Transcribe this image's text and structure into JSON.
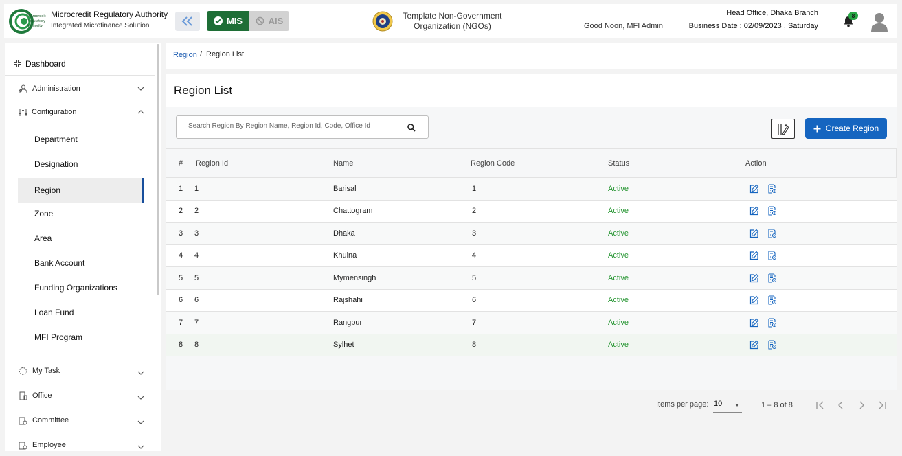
{
  "header": {
    "logo_text": [
      "Microcredit",
      "Regulatory",
      "Authority"
    ],
    "app_title": "Microcredit Regulatory Authority",
    "app_subtitle": "Integrated Microfinance Solution",
    "mis_label": "MIS",
    "ais_label": "AIS",
    "org_line1": "Template Non-Government",
    "org_line2": "Organization (NGOs)",
    "greeting": "Good Noon, MFI Admin",
    "branch": "Head Office, Dhaka Branch",
    "business_date": "Business Date : 02/09/2023 , Saturday",
    "notification_count": "8"
  },
  "sidebar": {
    "dashboard": "Dashboard",
    "items": [
      {
        "label": "Administration",
        "icon": "users-icon"
      },
      {
        "label": "Configuration",
        "icon": "sliders-icon"
      }
    ],
    "config_children": [
      "Department",
      "Designation",
      "Region",
      "Zone",
      "Area",
      "Bank Account",
      "Funding Organizations",
      "Loan Fund",
      "MFI Program"
    ],
    "lower_items": [
      {
        "label": "My Task",
        "icon": "task-icon"
      },
      {
        "label": "Office",
        "icon": "office-icon"
      },
      {
        "label": "Committee",
        "icon": "committee-icon"
      },
      {
        "label": "Employee",
        "icon": "employee-icon"
      }
    ],
    "active_child": "Region"
  },
  "breadcrumb": {
    "link": "Region",
    "separator": "/",
    "current": "Region List"
  },
  "page": {
    "title": "Region List",
    "search_placeholder": "Search Region By Region Name, Region Id, Code, Office Id",
    "create_label": "Create Region"
  },
  "table": {
    "headers": [
      "#",
      "Region Id",
      "Name",
      "Region Code",
      "Status",
      "Action"
    ],
    "rows": [
      {
        "n": "1",
        "id": "1",
        "name": "Barisal",
        "code": "1",
        "status": "Active"
      },
      {
        "n": "2",
        "id": "2",
        "name": "Chattogram",
        "code": "2",
        "status": "Active"
      },
      {
        "n": "3",
        "id": "3",
        "name": "Dhaka",
        "code": "3",
        "status": "Active"
      },
      {
        "n": "4",
        "id": "4",
        "name": "Khulna",
        "code": "4",
        "status": "Active"
      },
      {
        "n": "5",
        "id": "5",
        "name": "Mymensingh",
        "code": "5",
        "status": "Active"
      },
      {
        "n": "6",
        "id": "6",
        "name": "Rajshahi",
        "code": "6",
        "status": "Active"
      },
      {
        "n": "7",
        "id": "7",
        "name": "Rangpur",
        "code": "7",
        "status": "Active"
      },
      {
        "n": "8",
        "id": "8",
        "name": "Sylhet",
        "code": "8",
        "status": "Active"
      }
    ]
  },
  "paginator": {
    "items_per_page_label": "Items per page:",
    "page_size": "10",
    "range": "1 – 8 of 8"
  },
  "colors": {
    "brand_green": "#1e6e36",
    "primary_blue": "#1565c0",
    "status_active": "#23942f",
    "link_blue": "#1a5ab0"
  }
}
